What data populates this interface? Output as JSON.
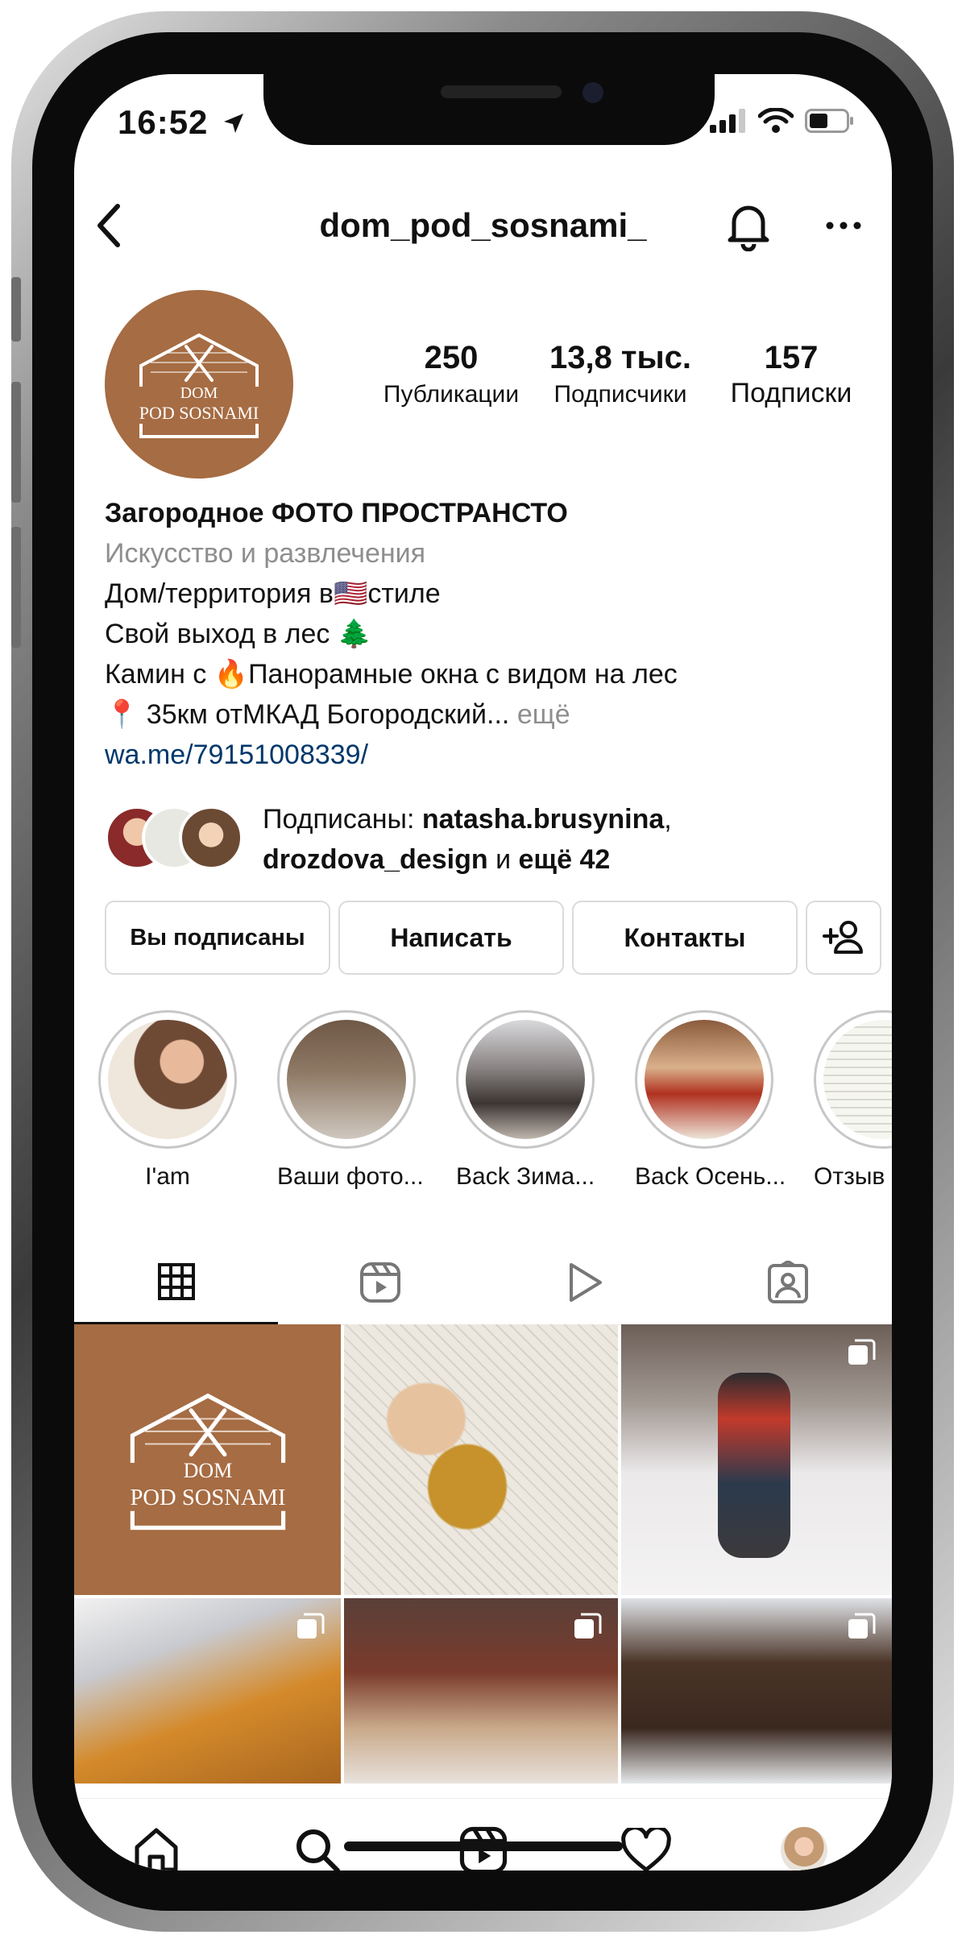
{
  "status": {
    "time": "16:52"
  },
  "header": {
    "username": "dom_pod_sosnami_"
  },
  "profile": {
    "logo_line1": "DOM",
    "logo_line2": "POD SOSNAMI",
    "stats": [
      {
        "value": "250",
        "label": "Публикации"
      },
      {
        "value": "13,8 тыс.",
        "label": "Подписчики"
      },
      {
        "value": "157",
        "label": "Подписки"
      }
    ],
    "bio": {
      "name": "Загородное ФОТО ПРОСТРАНСТО",
      "category": "Искусство и развлечения",
      "line1a": "Дом/территория в",
      "line1_flag": "🇺🇸",
      "line1b": "стиле",
      "line2a": "Свой выход в лес",
      "line2_icon": "🌲",
      "line3a": "Камин с",
      "line3_icon": "🔥",
      "line3b": "Панорамные окна с видом на лес",
      "line4_icon": "📍",
      "line4a": "35км отМКАД Богородский...",
      "line4_more": "ещё",
      "link": "wa.me/79151008339/"
    },
    "followed_by": {
      "prefix": "Подписаны:",
      "user1": "natasha.brusynina",
      "sep": ",",
      "user2": "drozdova_design",
      "and": "и",
      "rest": "ещё 42"
    }
  },
  "actions": {
    "following": "Вы подписаны",
    "message": "Написать",
    "contacts": "Контакты"
  },
  "highlights": [
    {
      "label": "I'am"
    },
    {
      "label": "Ваши фото..."
    },
    {
      "label": "Back Зима..."
    },
    {
      "label": "Back Осень..."
    },
    {
      "label": "Отзыв"
    }
  ],
  "colors": {
    "brand_brown": "#a66c43",
    "link_blue": "#00376b",
    "muted_gray": "#8e8e8e"
  },
  "icons": [
    "back-icon",
    "bell-icon",
    "more-icon",
    "grid-icon",
    "reels-icon",
    "play-icon",
    "tagged-icon",
    "home-icon",
    "search-icon",
    "heart-icon",
    "add-person-icon"
  ]
}
